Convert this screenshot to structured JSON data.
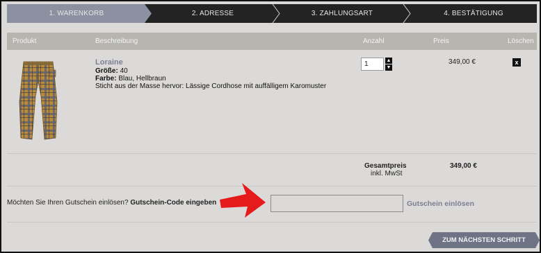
{
  "steps": [
    {
      "label": "1. WARENKORB",
      "active": true
    },
    {
      "label": "2. ADRESSE",
      "active": false
    },
    {
      "label": "3. ZAHLUNGSART",
      "active": false
    },
    {
      "label": "4. BESTÄTIGUNG",
      "active": false
    }
  ],
  "table": {
    "headers": {
      "product": "Produkt",
      "description": "Beschreibung",
      "quantity": "Anzahl",
      "price": "Preis",
      "delete": "Löschen"
    }
  },
  "item": {
    "name": "Loraine",
    "size_label": "Größe:",
    "size_value": "40",
    "color_label": "Farbe:",
    "color_value": "Blau, Hellbraun",
    "description": "Sticht aus der Masse hervor: Lässige Cordhose mit auffälligem Karomuster",
    "quantity": "1",
    "price": "349,00 €",
    "delete_icon": "x"
  },
  "summary": {
    "total_label": "Gesamtpreis",
    "tax_label": "inkl. MwSt",
    "total_value": "349,00 €"
  },
  "coupon": {
    "question": "Möchten Sie Ihren Gutschein einlösen?",
    "enter_code": "Gutschein-Code eingeben",
    "input_value": "",
    "redeem_label": "Gutschein einlösen"
  },
  "next_button": "ZUM NÄCHSTEN SCHRITT",
  "colors": {
    "accent": "#7a7f93",
    "arrow": "#e51b1b",
    "background": "#dcdad8",
    "steps_bar": "#232323"
  }
}
